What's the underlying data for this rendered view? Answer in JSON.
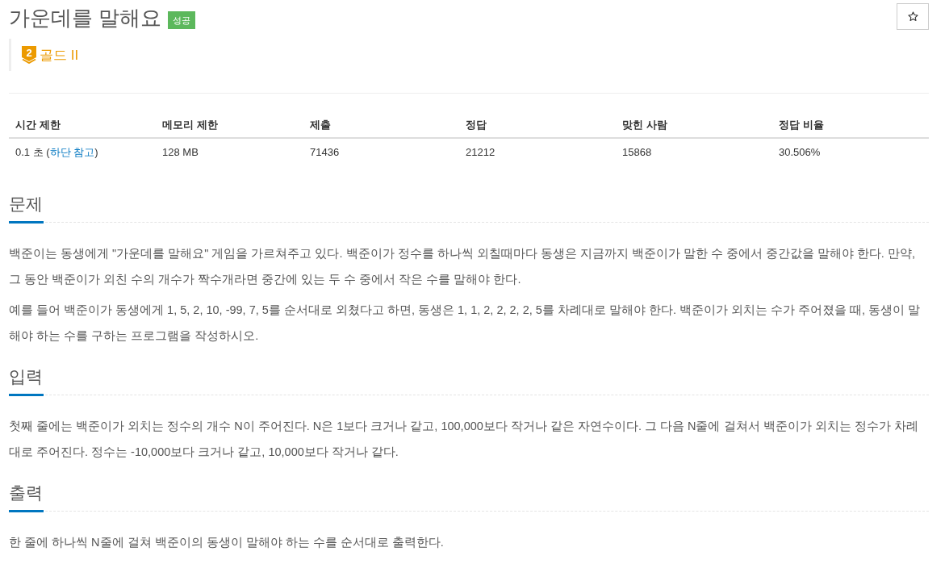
{
  "title": "가운데를 말해요",
  "result_badge": "성공",
  "favorite": {
    "starred": false
  },
  "tier": {
    "number": "2",
    "label": "골드 II"
  },
  "stats": {
    "columns": [
      "시간 제한",
      "메모리 제한",
      "제출",
      "정답",
      "맞힌 사람",
      "정답 비율"
    ],
    "rows": [
      [
        {
          "parts": [
            {
              "kind": "text",
              "text": "0.1 초 ("
            },
            {
              "kind": "link",
              "text": "하단 참고"
            },
            {
              "kind": "text",
              "text": ")"
            }
          ]
        },
        {
          "parts": [
            {
              "kind": "text",
              "text": "128 MB"
            }
          ]
        },
        {
          "parts": [
            {
              "kind": "text",
              "text": "71436"
            }
          ]
        },
        {
          "parts": [
            {
              "kind": "text",
              "text": "21212"
            }
          ]
        },
        {
          "parts": [
            {
              "kind": "text",
              "text": "15868"
            }
          ]
        },
        {
          "parts": [
            {
              "kind": "text",
              "text": "30.506%"
            }
          ]
        }
      ]
    ]
  },
  "sections": [
    {
      "heading": "문제",
      "paragraphs": [
        "백준이는 동생에게 \"가운데를 말해요\" 게임을 가르쳐주고 있다. 백준이가 정수를 하나씩 외칠때마다 동생은 지금까지 백준이가 말한 수 중에서 중간값을 말해야 한다. 만약, 그 동안 백준이가 외친 수의 개수가 짝수개라면 중간에 있는 두 수 중에서 작은 수를 말해야 한다.",
        "예를 들어 백준이가 동생에게 1, 5, 2, 10, -99, 7, 5를 순서대로 외쳤다고 하면, 동생은 1, 1, 2, 2, 2, 2, 5를 차례대로 말해야 한다. 백준이가 외치는 수가 주어졌을 때, 동생이 말해야 하는 수를 구하는 프로그램을 작성하시오."
      ]
    },
    {
      "heading": "입력",
      "paragraphs": [
        "첫째 줄에는 백준이가 외치는 정수의 개수 N이 주어진다. N은 1보다 크거나 같고, 100,000보다 작거나 같은 자연수이다. 그 다음 N줄에 걸쳐서 백준이가 외치는 정수가 차례대로 주어진다. 정수는 -10,000보다 크거나 같고, 10,000보다 작거나 같다."
      ]
    },
    {
      "heading": "출력",
      "paragraphs": [
        "한 줄에 하나씩 N줄에 걸쳐 백준이의 동생이 말해야 하는 수를 순서대로 출력한다."
      ]
    }
  ]
}
